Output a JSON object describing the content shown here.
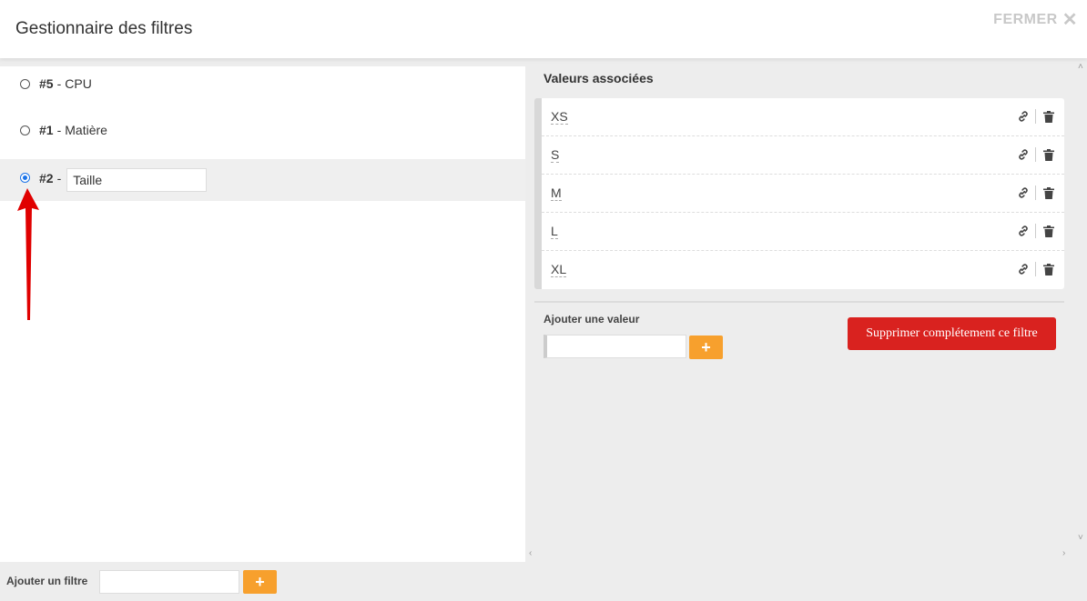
{
  "header": {
    "title": "Gestionnaire des filtres",
    "close_label": "FERMER",
    "close_icon": "close-icon"
  },
  "filters": [
    {
      "num": "#5",
      "name": "CPU",
      "selected": false
    },
    {
      "num": "#1",
      "name": "Matière",
      "selected": false
    },
    {
      "num": "#2",
      "name": "Taille",
      "selected": true
    }
  ],
  "add_filter": {
    "label": "Ajouter un filtre",
    "value": "",
    "button": "+"
  },
  "values_panel": {
    "title": "Valeurs associées",
    "values": [
      "XS",
      "S",
      "M",
      "L",
      "XL"
    ]
  },
  "add_value": {
    "label": "Ajouter une valeur",
    "value": "",
    "button": "+"
  },
  "delete_filter_label": "Supprimer complétement ce filtre",
  "colors": {
    "accent_orange": "#f7a02d",
    "danger_red": "#d9221f",
    "radio_blue": "#1a73e8",
    "annotation_arrow": "#e00000"
  }
}
